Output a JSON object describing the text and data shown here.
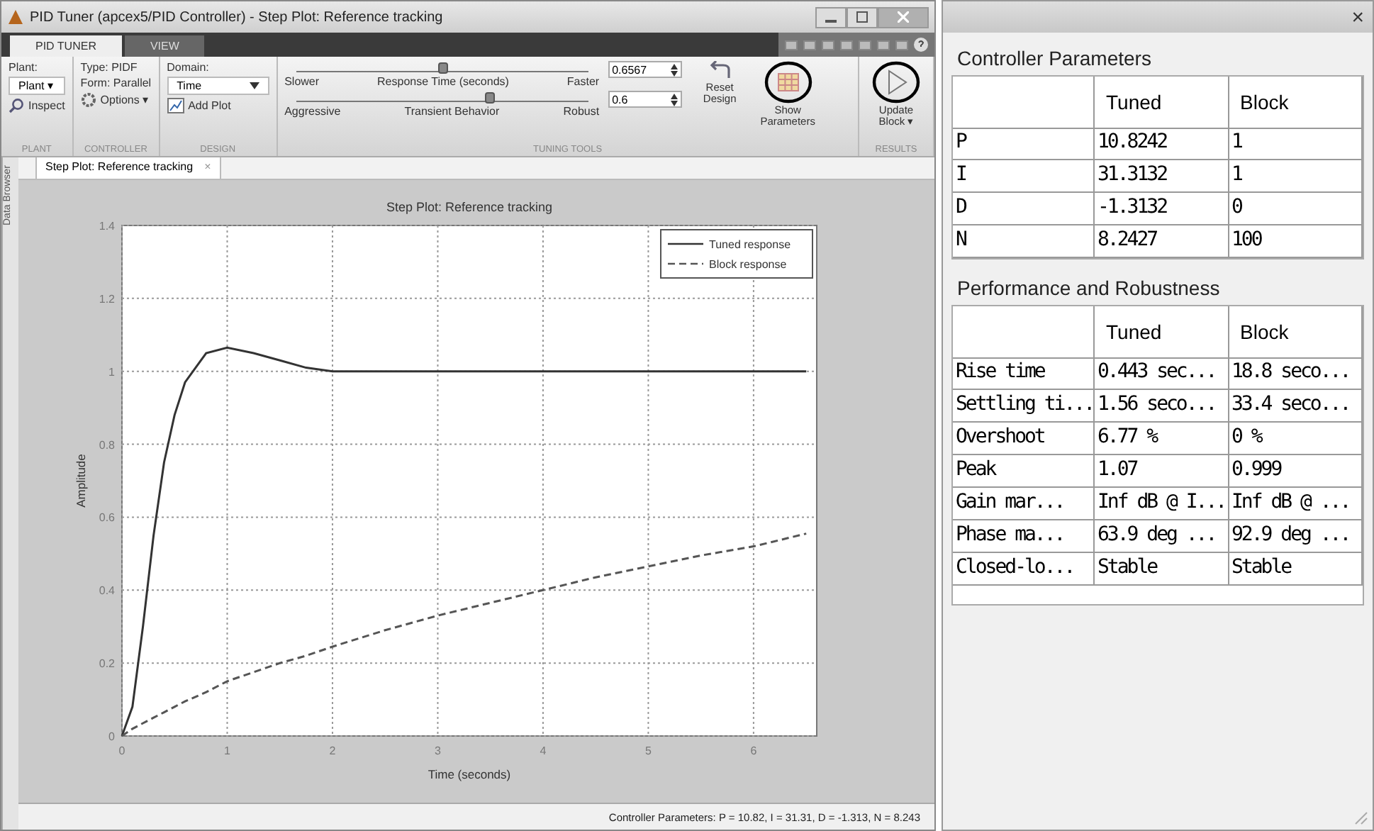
{
  "window": {
    "title": "PID Tuner (apcex5/PID Controller) - Step Plot: Reference tracking"
  },
  "tabs": [
    {
      "label": "PID TUNER",
      "selected": true
    },
    {
      "label": "VIEW",
      "selected": false
    }
  ],
  "ribbon": {
    "plant": {
      "label": "Plant:",
      "dropdown": "Plant ▾",
      "inspect": "Inspect",
      "section": "PLANT"
    },
    "controller": {
      "type": "Type: PIDF",
      "form": "Form: Parallel",
      "options": "Options ▾",
      "section": "CONTROLLER"
    },
    "design": {
      "domain_label": "Domain:",
      "domain": "Time",
      "add_plot": "Add Plot",
      "section": "DESIGN"
    },
    "tuning": {
      "section": "TUNING TOOLS",
      "sliders": [
        {
          "left": "Slower",
          "middle": "Response Time (seconds)",
          "right": "Faster",
          "level": 0.5,
          "value": "0.6567"
        },
        {
          "left": "Aggressive",
          "middle": "Transient Behavior",
          "right": "Robust",
          "level": 0.66,
          "value": "0.6"
        }
      ],
      "reset": "Reset Design",
      "show": "Show Parameters"
    },
    "results": {
      "update": "Update Block ▾",
      "section": "RESULTS"
    }
  },
  "document_tab": {
    "label": "Step Plot: Reference tracking",
    "close": "×"
  },
  "side_label": "Data Browser",
  "plot": {
    "chart_data": {
      "type": "line",
      "title": "Step Plot: Reference tracking",
      "xlabel": "Time (seconds)",
      "ylabel": "Amplitude",
      "x": [
        0,
        0.1,
        0.2,
        0.3,
        0.4,
        0.5,
        0.6,
        0.8,
        1,
        1.25,
        1.5,
        1.75,
        2,
        2.5,
        3,
        3.5,
        4,
        4.5,
        5,
        5.5,
        6,
        6.5
      ],
      "series": [
        {
          "name": "Tuned response",
          "color": "#333333",
          "line_style": "solid",
          "values": [
            0,
            0.08,
            0.3,
            0.55,
            0.75,
            0.88,
            0.97,
            1.05,
            1.065,
            1.05,
            1.03,
            1.01,
            1.0,
            1,
            1,
            1,
            1,
            1,
            1,
            1,
            1,
            1
          ]
        },
        {
          "name": "Block response",
          "color": "#555555",
          "line_style": "dashed",
          "values": [
            0,
            0.02,
            0.035,
            0.05,
            0.065,
            0.08,
            0.095,
            0.12,
            0.15,
            0.175,
            0.2,
            0.22,
            0.245,
            0.29,
            0.33,
            0.365,
            0.4,
            0.435,
            0.465,
            0.495,
            0.52,
            0.555
          ]
        }
      ],
      "grid": true,
      "legend": true,
      "xlim": [
        0,
        6.6
      ],
      "ylim": [
        0,
        1.4
      ],
      "xticks": [
        0,
        1,
        2,
        3,
        4,
        5,
        6
      ],
      "yticks": [
        0,
        0.2,
        0.4,
        0.6,
        0.8,
        1,
        1.2,
        1.4
      ]
    }
  },
  "status_bar": "Controller Parameters: P = 10.82, I = 31.31, D = -1.313, N = 8.243",
  "panel": {
    "close": "×",
    "controller": {
      "title": "Controller Parameters",
      "columns": [
        "",
        "Tuned",
        "Block"
      ],
      "rows": [
        [
          "P",
          "10.8242",
          "1"
        ],
        [
          "I",
          "31.3132",
          "1"
        ],
        [
          "D",
          "-1.3132",
          "0"
        ],
        [
          "N",
          "8.2427",
          "100"
        ]
      ]
    },
    "performance": {
      "title": "Performance and Robustness",
      "columns": [
        "",
        "Tuned",
        "Block"
      ],
      "rows": [
        [
          "Rise time",
          "0.443 sec...",
          "18.8 seco..."
        ],
        [
          "Settling ti...",
          "1.56 seco...",
          "33.4 seco..."
        ],
        [
          "Overshoot",
          "6.77 %",
          "0 %"
        ],
        [
          "Peak",
          "1.07",
          "0.999"
        ],
        [
          "Gain mar...",
          "Inf dB @ I...",
          "Inf dB @ ..."
        ],
        [
          "Phase ma...",
          "63.9 deg ...",
          "92.9 deg ..."
        ],
        [
          "Closed-lo...",
          "Stable",
          "Stable"
        ]
      ]
    }
  }
}
